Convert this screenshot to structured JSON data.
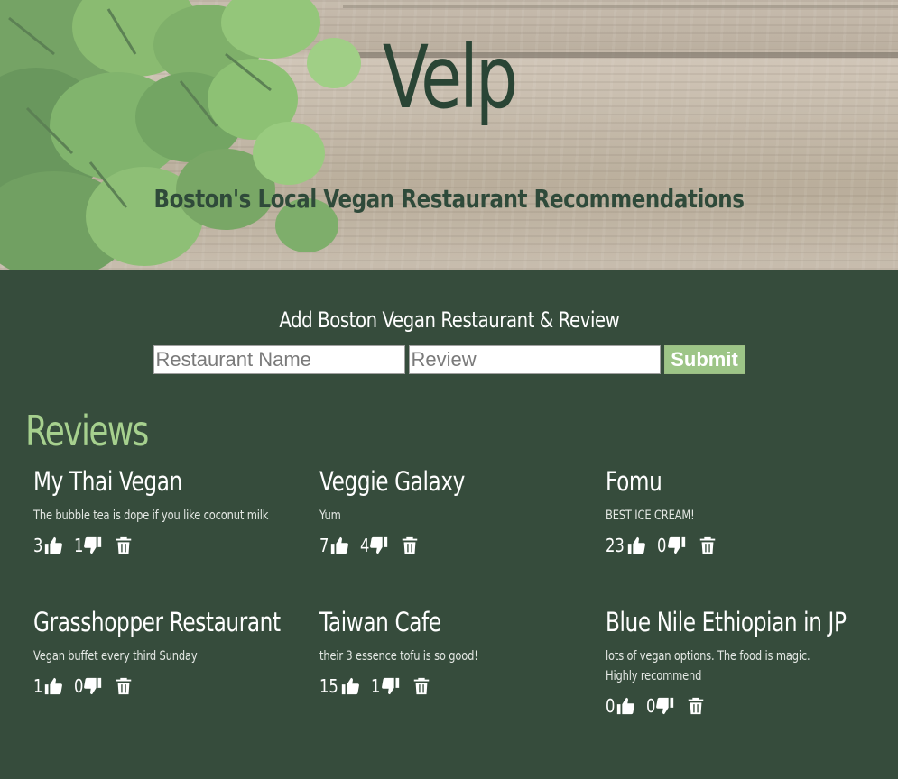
{
  "hero": {
    "title": "Velp",
    "subtitle": "Boston's Local Vegan Restaurant Recommendations"
  },
  "form": {
    "heading": "Add Boston Vegan Restaurant & Review",
    "name_placeholder": "Restaurant Name",
    "review_placeholder": "Review",
    "submit_label": "Submit"
  },
  "reviews": {
    "heading": "Reviews",
    "items": [
      {
        "name": "My Thai Vegan",
        "review": "The bubble tea is dope if you like coconut milk",
        "up": "3",
        "down": "1"
      },
      {
        "name": "Veggie Galaxy",
        "review": "Yum",
        "up": "7",
        "down": "4"
      },
      {
        "name": "Fomu",
        "review": "BEST ICE CREAM!",
        "up": "23",
        "down": "0"
      },
      {
        "name": "Grasshopper Restaurant",
        "review": "Vegan buffet every third Sunday",
        "up": "1",
        "down": "0"
      },
      {
        "name": "Taiwan Cafe",
        "review": "their 3 essence tofu is so good!",
        "up": "15",
        "down": "1"
      },
      {
        "name": "Blue Nile Ethiopian in JP",
        "review": "lots of vegan options. The food is magic. Highly recommend",
        "up": "0",
        "down": "0"
      }
    ]
  },
  "icons": {
    "thumbs_up": "thumbs-up-icon",
    "thumbs_down": "thumbs-down-icon",
    "trash": "trash-icon"
  },
  "colors": {
    "background": "#364c3c",
    "accent": "#a6d08e",
    "submit": "#9dc587",
    "title": "#2a4535"
  }
}
